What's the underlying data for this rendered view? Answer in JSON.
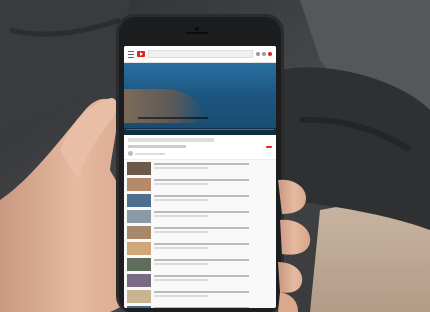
{
  "scene": {
    "description_free": true,
    "colors": {
      "background_sofa": "#4a4b4c",
      "sleeve": "#3d3e40",
      "skin": "#e0b29a",
      "phone_body": "#2b2c2e",
      "youtube_red": "#e62117"
    }
  },
  "phone_screen": {
    "app_icon": "youtube-logo",
    "video": {
      "progress_fraction": 0.02
    },
    "list_thumb_colors": [
      "#6b5a4a",
      "#b58a6a",
      "#4f6f8f",
      "#8a9aa5",
      "#a7886b",
      "#d0a878",
      "#5e6e5a",
      "#7b6a84",
      "#c8b490",
      "#486b8c"
    ]
  }
}
